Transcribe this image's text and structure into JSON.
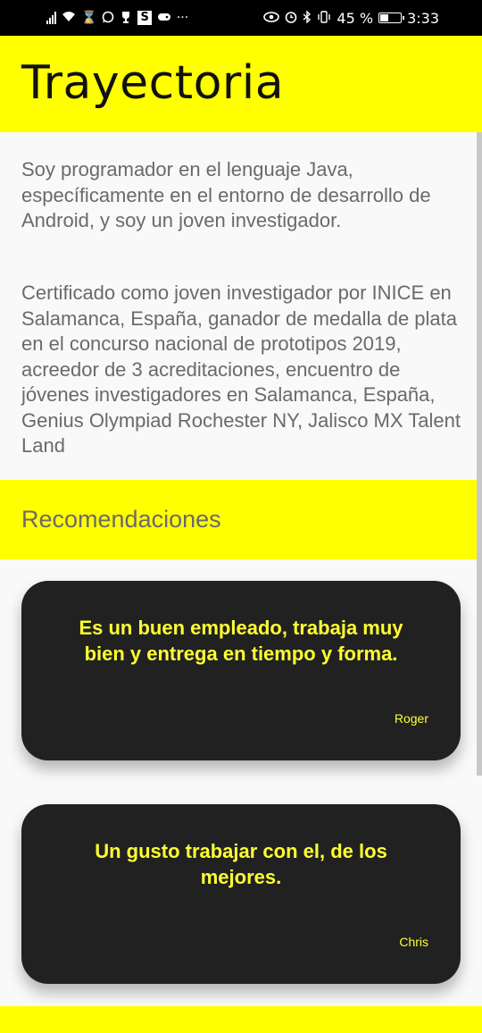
{
  "status_bar": {
    "left_icons": [
      "signal-icon",
      "wifi-icon",
      "hourglass-icon",
      "whatsapp-icon",
      "trophy-icon",
      "s-app-icon",
      "gamepad-icon",
      "more-icon"
    ],
    "more": "···",
    "s_label": "S",
    "battery_text": "45 %",
    "battery_level": 0.45,
    "time": "3:33"
  },
  "header": {
    "title": "Trayectoria"
  },
  "about": {
    "paragraph_1": "Soy programador en el lenguaje Java, específicamente en el entorno de desarrollo de Android, y soy un joven investigador.",
    "paragraph_2": "Certificado como joven investigador por INICE en Salamanca, España, ganador de medalla de plata en el concurso nacional de prototipos 2019, acreedor de 3 acreditaciones, encuentro de jóvenes investigadores en Salamanca, España, Genius Olympiad Rochester NY, Jalisco MX Talent Land"
  },
  "recommendations": {
    "title": "Recomendaciones",
    "items": [
      {
        "quote": "Es un buen empleado, trabaja muy bien y entrega en tiempo y forma.",
        "author": "Roger"
      },
      {
        "quote": "Un gusto trabajar con el, de los mejores.",
        "author": "Chris"
      }
    ]
  },
  "colors": {
    "accent": "#ffff00",
    "card_background": "#212121",
    "card_text": "#ffff33",
    "body_text": "#6a6a6a"
  }
}
